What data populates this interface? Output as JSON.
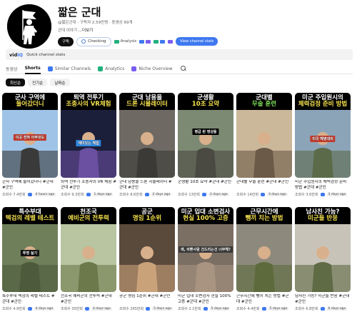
{
  "channel": {
    "name": "짧은 군대",
    "handle": "@짧은군대",
    "subscribers": "구독자 2.59만명",
    "videos": "동영상 69개",
    "description_prefix": "군대 이야기",
    "description_more": "...더보기"
  },
  "buttons": {
    "subscribe": "구독",
    "checking": "Checking",
    "analysis": "Analysis",
    "view_stats": "View channel stats"
  },
  "vidiq": {
    "logo_a": "vid",
    "logo_b": "IQ",
    "label": "Quick channel stats"
  },
  "tabs": [
    {
      "label": "동영상"
    },
    {
      "label": "Shorts"
    },
    {
      "label": "Similar Channels"
    },
    {
      "label": "Analytics"
    },
    {
      "label": "Niche Overview"
    }
  ],
  "chips": [
    {
      "label": "최신순"
    },
    {
      "label": "인기순"
    },
    {
      "label": "날짜순"
    }
  ],
  "colors": {
    "accent_blue": "#3e78f0",
    "caption_yellow": "#f4e04d",
    "caption_green": "#7ed957"
  },
  "shorts": [
    {
      "cap1": "군사 구역에",
      "cap2": "들어갔더니",
      "title": "군사 구역에 들어갔더니 #군대 #군인",
      "views": "조회수 7.4만회",
      "ago": "4 hours ago",
      "overlay": "이곳 전혀 아무것도"
    },
    {
      "cap1": "퇴역 전투기",
      "cap2": "조종사의 VR체험",
      "title": "퇴역 전투기 조종사의 VR 체험 #군대 #군인",
      "views": "조회수 9.3만회",
      "ago": "1 days ago",
      "overlay": "재미있는 체험"
    },
    {
      "cap1": "군대 남용을",
      "cap2": "드론 시뮬레이터",
      "title": "군대 남용을 드론 시뮬레이터 #군대 #군인",
      "views": "조회수 8.6만회",
      "ago": "2 days ago",
      "overlay": ""
    },
    {
      "cap1": "군생활",
      "cap2": "10초 요약",
      "title": "군생활 10초 요약 #군대 #군인",
      "views": "조회수 13만회",
      "ago": "2 days ago",
      "overlay": "병급 된 영상들"
    },
    {
      "cap1": "군대별",
      "cap2": "무술 훈련",
      "title": "군대별 무술 훈련 #군대 #군인",
      "views": "조회수 14만회",
      "ago": "3 days ago",
      "overlay": ""
    },
    {
      "cap1": "미군 주입원시의",
      "cap2": "체력검정 준비 방법",
      "title": "미군 주입원시의 체력검정 준비 방법 #군대 #군인",
      "views": "조회수 3.6만회",
      "ago": "3 days ago",
      "overlay": "미국 해병대의"
    },
    {
      "cap1": "특수부대",
      "cap2": "텍검의 레벨 테스트",
      "title": "특수부대 텍검의 레벨 테스트 #군대 #군인",
      "views": "조회수 4.9만회",
      "ago": "4 days ago",
      "overlay": "투명 실기"
    },
    {
      "cap1": "천조국",
      "cap2": "예비군의 전투력",
      "title": "천조국 예비군의 전투력 #군대 #군인",
      "views": "조회수 35만회",
      "ago": "4 days ago",
      "overlay": ""
    },
    {
      "cap1": "공군",
      "cap2": "명임 1순위",
      "title": "공군 명임 1순위 #군대 #군인",
      "views": "조회수 265만회",
      "ago": "5 days ago",
      "overlay": ""
    },
    {
      "cap1": "미군 입대 소변검사",
      "cap2": "현실 100% 고증",
      "title": "미군 입대 소변검사 현실 100% 고증 #군대 #군인",
      "views": "조회수 2.1만회",
      "ago": "5 days ago",
      "overlay": "왜, 바쁜사람 건드리는건 너무해?"
    },
    {
      "cap1": "근무시간에",
      "cap2": "뺑끼 치는 방법",
      "title": "근무시간에 뺑끼 치는 방법 #군대 #군인",
      "views": "조회수 4.4만회",
      "ago": "5 days ago",
      "overlay": ""
    },
    {
      "cap1": "남사친 가능?",
      "cap2": "미군들 반응",
      "title": "남사친 가능? 미군들 반응 #군대 #군인",
      "views": "조회수 6.8만회",
      "ago": "6 days ago",
      "overlay": ""
    }
  ]
}
